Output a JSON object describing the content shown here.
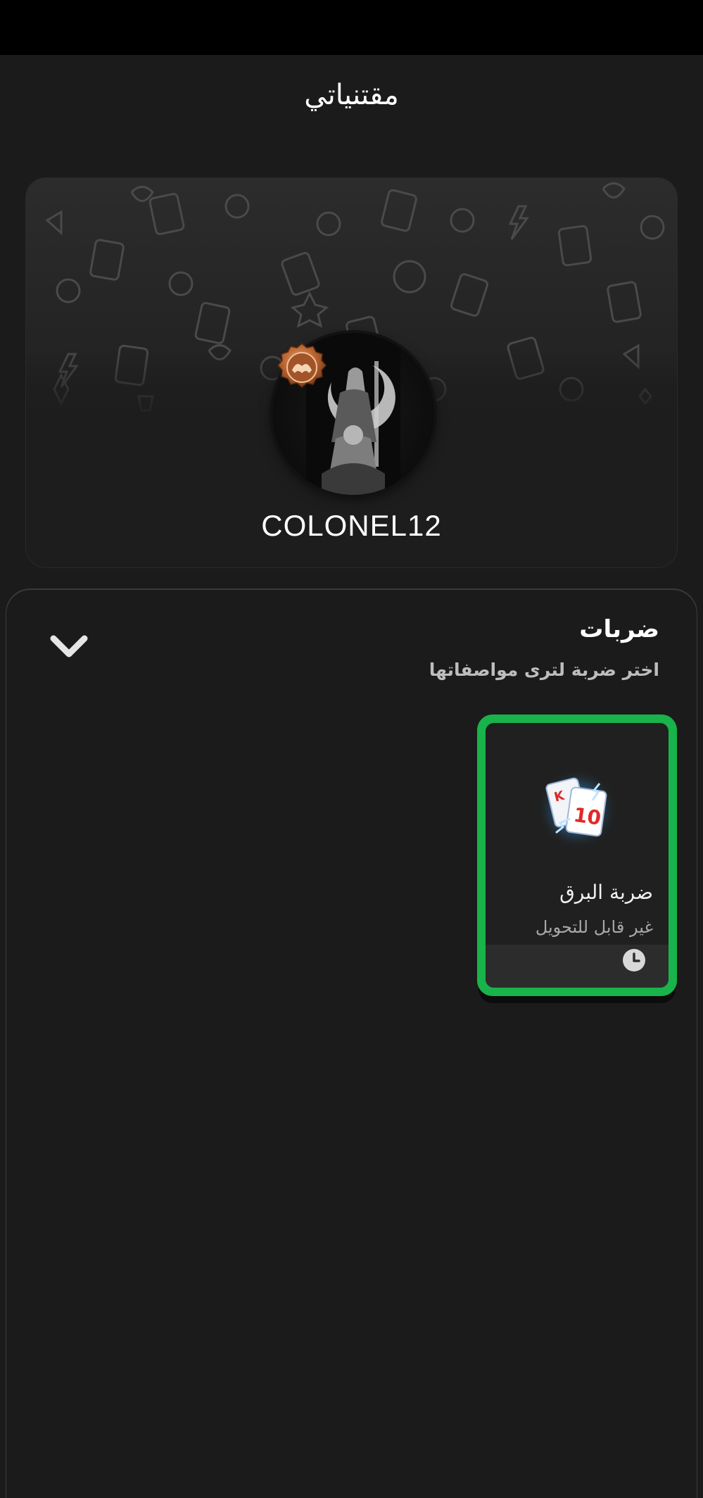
{
  "header": {
    "title": "مقتنياتي"
  },
  "profile": {
    "username": "COLONEL12",
    "avatar": "avatar-image",
    "badge": "bronze-level-badge"
  },
  "section": {
    "title": "ضربات",
    "subtitle": "اختر ضربة لترى مواصفاتها",
    "collapse_icon": "chevron-down-icon"
  },
  "items": [
    {
      "name": "ضربة البرق",
      "status": "غير قابل للتحويل",
      "icon": "lightning-cards-icon",
      "footer_icon": "clock-icon",
      "selected": true
    }
  ],
  "colors": {
    "background": "#1b1b1b",
    "status_bar": "#000000",
    "selected_border": "#18b34a",
    "card_background": "#202020"
  }
}
